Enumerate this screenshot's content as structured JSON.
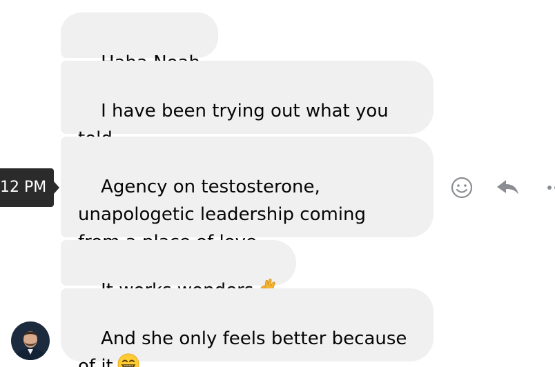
{
  "messages": [
    {
      "text": "Haha Noah"
    },
    {
      "text": "I have been trying out what you told\nme yesterday."
    },
    {
      "text": "Agency on testosterone,\nunapologetic leadership coming\nfrom a place of love"
    },
    {
      "text": "It works wonders",
      "emoji": "ok-hand-emoji"
    },
    {
      "text": "And she only feels better because\nof it",
      "emoji": "grinning-face-emoji"
    }
  ],
  "hover_timestamp": "12 PM",
  "message_actions": [
    "react-icon",
    "reply-icon",
    "more-icon"
  ],
  "colors": {
    "bubble_background": "#f0f0f0",
    "text": "#050505",
    "tooltip_background": "#2b2b2b",
    "icon": "#8a8d91"
  }
}
